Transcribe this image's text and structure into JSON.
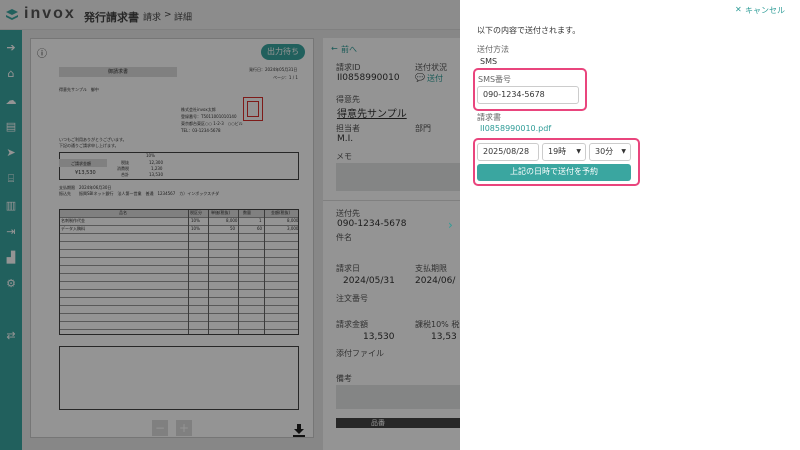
{
  "header": {
    "logo": "invox",
    "app_name": "発行請求書",
    "breadcrumb": [
      "請求",
      "詳細"
    ],
    "breadcrumb_sep": ">"
  },
  "document": {
    "status_button": "出力待ち",
    "title": "御請求書",
    "issue_date": "発行日：2024年05月31日",
    "page": "ページ：1 / 1",
    "recipient": "得意先サンプル　御中",
    "sender_lines": [
      "株式会社invox太郎",
      "登録番号：T5011001010140",
      "東京都台東区○○ 1-2-3　○○ビル",
      "TEL：03-1234-5678"
    ],
    "greeting": [
      "いつもご利用ありがとうございます。",
      "下記の通りご請求申し上げます。"
    ],
    "amount_label": "ご請求金額",
    "amount": "¥13,530",
    "tax_rate_header": "10%",
    "tax_rows": [
      {
        "label": "税抜",
        "value": "12,300"
      },
      {
        "label": "消費税",
        "value": "1,230"
      },
      {
        "label": "合計",
        "value": "13,530"
      }
    ],
    "due_label": "支払期限",
    "due_date": "2024年06月30日",
    "bank_label": "振込先",
    "bank": "振興SBIネット銀行　法人第一営業　普通　1234567　カ）インボックスチダ",
    "item_headers": [
      "品名",
      "税区分",
      "単価(税抜)",
      "数量",
      "金額(税抜)"
    ],
    "items": [
      {
        "name": "名刺制作代金",
        "tax": "10%",
        "price": "8,000",
        "qty": "1",
        "amount": "8,000"
      },
      {
        "name": "データ入稿料",
        "tax": "10%",
        "price": "50",
        "qty": "60",
        "amount": "3,000"
      }
    ],
    "zoom_out": "−",
    "zoom_in": "+"
  },
  "detail": {
    "prev": "前へ",
    "invoice_id_label": "請求ID",
    "invoice_id": "II0858990010",
    "send_status_label": "送付状況",
    "send_status": "送付",
    "customer_label": "得意先",
    "customer": "得意先サンプル",
    "person_label": "担当者",
    "person": "M.I.",
    "dept_label": "部門",
    "memo_label": "メモ",
    "destination_label": "送付先",
    "destination": "090-1234-5678",
    "subject_label": "件名",
    "invoice_date_label": "請求日",
    "invoice_date": "2024/05/31",
    "due_label": "支払期限",
    "due_date": "2024/06/",
    "order_label": "注文番号",
    "amount_label": "請求金額",
    "amount": "13,530",
    "tax_label": "課税10% 税込",
    "tax_amount": "13,53",
    "attach_label": "添付ファイル",
    "remarks_label": "備考",
    "item_col": "品番"
  },
  "panel": {
    "cancel": "キャンセル",
    "intro": "以下の内容で送付されます。",
    "method_label": "送付方法",
    "method": "SMS",
    "sms_label": "SMS番号",
    "sms_value": "090-1234-5678",
    "invoice_label": "請求書",
    "invoice_file": "II0858990010.pdf",
    "date": "2025/08/28",
    "hour": "19時",
    "minute": "30分",
    "schedule_button": "上記の日時で送付を予約"
  },
  "colors": {
    "accent": "#3aa6a0",
    "highlight": "#e9457d",
    "stamp": "#d9302c"
  }
}
